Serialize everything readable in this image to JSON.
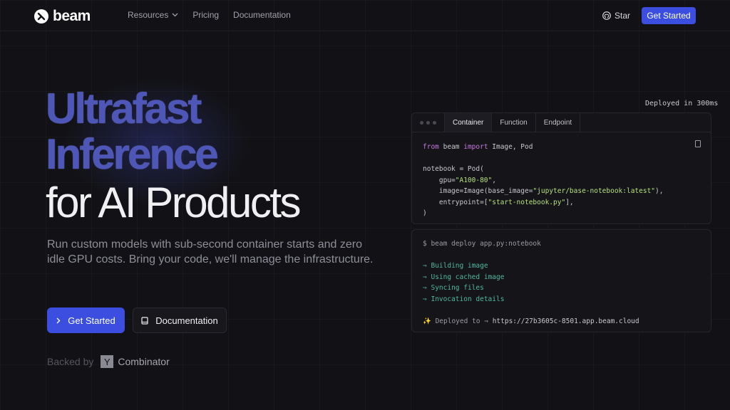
{
  "nav": {
    "brand": "beam",
    "links": [
      {
        "label": "Resources",
        "dropdown": true
      },
      {
        "label": "Pricing"
      },
      {
        "label": "Documentation"
      }
    ],
    "star_label": "Star",
    "cta_label": "Get Started"
  },
  "hero": {
    "line1": "Ultrafast",
    "line2": "Inference",
    "line3": "for AI Products",
    "subtitle": "Run custom models with sub-second container starts and zero idle GPU costs. Bring your code, we'll manage the infrastructure.",
    "primary_label": "Get Started",
    "secondary_label": "Documentation",
    "backed_label": "Backed by",
    "backer_mark": "Y",
    "backer_name": "Combinator"
  },
  "code_panel": {
    "deployed_label": "Deployed in 300ms",
    "tabs": [
      "Container",
      "Function",
      "Endpoint"
    ],
    "active_tab": "Container",
    "lines": [
      {
        "parts": [
          [
            "kw",
            "from"
          ],
          [
            "t",
            " beam "
          ],
          [
            "kw",
            "import"
          ],
          [
            "t",
            " Image, Pod"
          ]
        ]
      },
      {
        "parts": [
          [
            "t",
            ""
          ]
        ]
      },
      {
        "parts": [
          [
            "t",
            "notebook = Pod("
          ]
        ]
      },
      {
        "parts": [
          [
            "t",
            "    gpu="
          ],
          [
            "str",
            "\"A100-80\""
          ],
          [
            "t",
            ","
          ]
        ]
      },
      {
        "parts": [
          [
            "t",
            "    image=Image(base_image="
          ],
          [
            "str",
            "\"jupyter/base-notebook:latest\""
          ],
          [
            "t",
            "),"
          ]
        ]
      },
      {
        "parts": [
          [
            "t",
            "    entrypoint=["
          ],
          [
            "str",
            "\"start-notebook.py\""
          ],
          [
            "t",
            "],"
          ]
        ]
      },
      {
        "parts": [
          [
            "t",
            ")"
          ]
        ]
      }
    ]
  },
  "terminal": {
    "command": "$ beam deploy app.py:notebook",
    "arrow_glyph": "⇒",
    "steps": [
      "Building image",
      "Using cached image",
      "Syncing files",
      "Invocation details"
    ],
    "sparkle": "✨",
    "deployed_prefix": "Deployed to",
    "deployed_url": "https://27b3605c-8501.app.beam.cloud"
  },
  "colors": {
    "accent": "#3b4ee0",
    "background": "#121216",
    "hero_outline": "#4e56b8",
    "code_keyword": "#c678dd",
    "code_string": "#b5e07a",
    "terminal_step": "#4fb8a0"
  }
}
